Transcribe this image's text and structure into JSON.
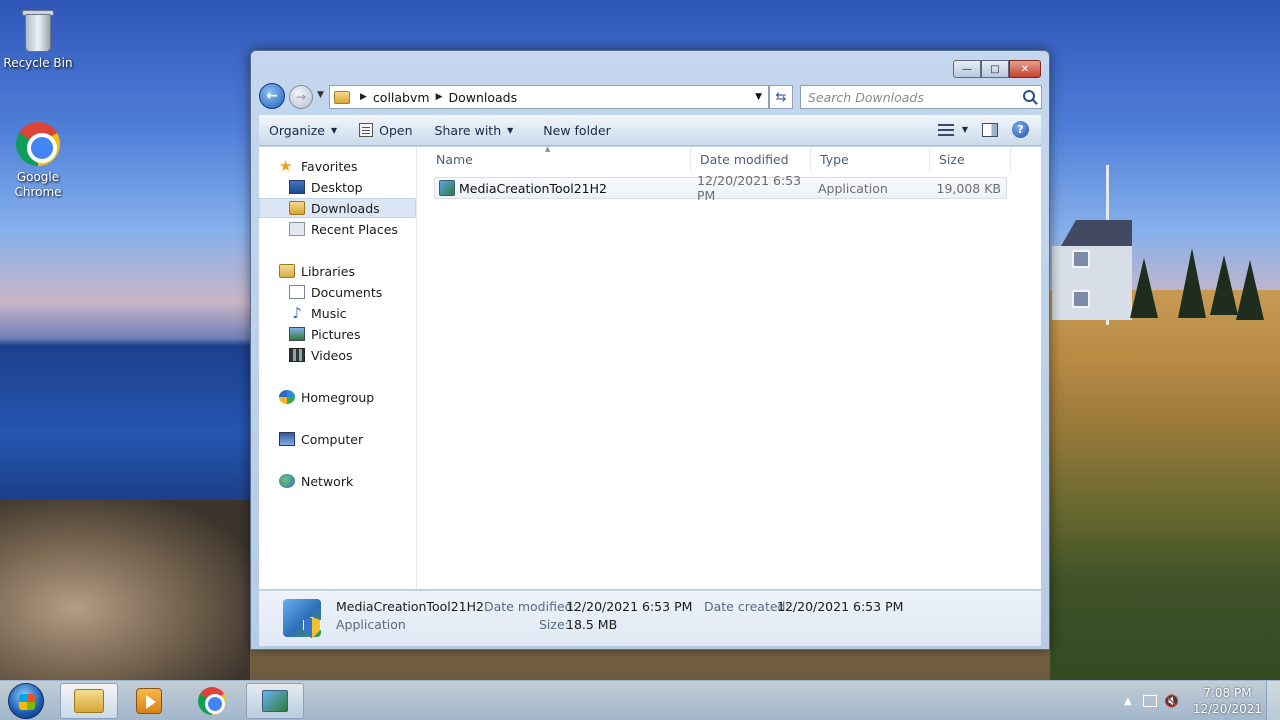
{
  "desktop": {
    "icons": [
      {
        "label": "Recycle Bin"
      },
      {
        "label": "Google Chrome"
      }
    ]
  },
  "window": {
    "address": {
      "crumbs": [
        "collabvm",
        "Downloads"
      ]
    },
    "search": {
      "placeholder": "Search Downloads"
    },
    "toolbar": {
      "organize_label": "Organize",
      "open_label": "Open",
      "share_label": "Share with",
      "new_folder_label": "New folder"
    },
    "nav": {
      "favorites": "Favorites",
      "desktop": "Desktop",
      "downloads": "Downloads",
      "recent": "Recent Places",
      "libraries": "Libraries",
      "documents": "Documents",
      "music": "Music",
      "pictures": "Pictures",
      "videos": "Videos",
      "homegroup": "Homegroup",
      "computer": "Computer",
      "network": "Network"
    },
    "columns": {
      "name": "Name",
      "date": "Date modified",
      "type": "Type",
      "size": "Size"
    },
    "files": [
      {
        "name": "MediaCreationTool21H2",
        "date": "12/20/2021 6:53 PM",
        "type": "Application",
        "size": "19,008 KB"
      }
    ],
    "details": {
      "name": "MediaCreationTool21H2",
      "type": "Application",
      "date_modified_label": "Date modified:",
      "date_modified": "12/20/2021 6:53 PM",
      "date_created_label": "Date created:",
      "date_created": "12/20/2021 6:53 PM",
      "size_label": "Size:",
      "size": "18.5 MB"
    }
  },
  "taskbar": {
    "time": "7:08 PM",
    "date": "12/20/2021"
  }
}
